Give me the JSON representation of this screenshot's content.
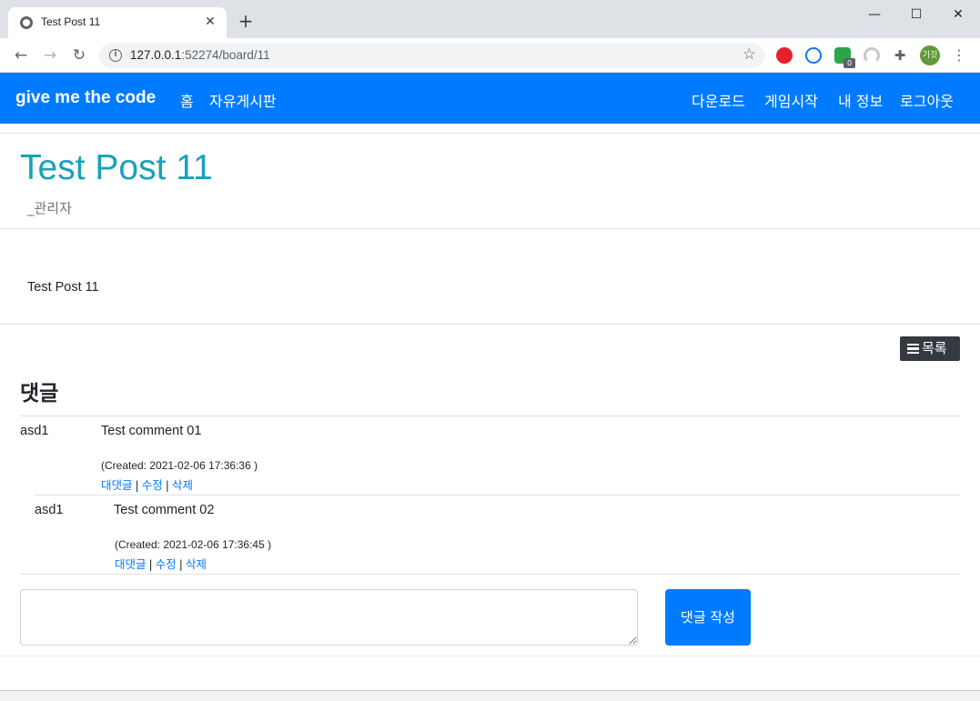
{
  "browser": {
    "tab_title": "Test Post 11",
    "tab_close": "✕",
    "new_tab": "+",
    "window_min": "—",
    "window_max": "☐",
    "window_close": "✕",
    "url_host": "127.0.0.1",
    "url_path": ":52274/board/11",
    "back": "←",
    "forward": "→",
    "reload": "↻",
    "info": "i",
    "star": "☆",
    "extension_badge": "0",
    "avatar_text": "기깃",
    "menu": "⋮",
    "puzzle": "✚"
  },
  "navbar": {
    "brand": "give me the code",
    "left_links": [
      "홈",
      "자유게시판"
    ],
    "right_links": [
      "다운로드",
      "게임시작",
      "내 정보",
      "로그아웃"
    ]
  },
  "post": {
    "title": "Test Post 11",
    "author": "_관리자",
    "body": "Test Post 11"
  },
  "list_button": "목록",
  "comments": {
    "heading": "댓글",
    "items": [
      {
        "author": "asd1",
        "text": "Test comment 01",
        "created": "(Created: 2021-02-06 17:36:36 )",
        "actions": [
          "대댓글",
          "수정",
          "삭제"
        ]
      },
      {
        "author": "asd1",
        "text": "Test comment 02",
        "created": "(Created: 2021-02-06 17:36:45 )",
        "actions": [
          "대댓글",
          "수정",
          "삭제"
        ]
      }
    ],
    "submit_label": "댓글 작성",
    "input_value": ""
  },
  "colors": {
    "navbar": "#007bff",
    "title": "#17a2b8",
    "link": "#007bff",
    "dark_button": "#343a40"
  }
}
